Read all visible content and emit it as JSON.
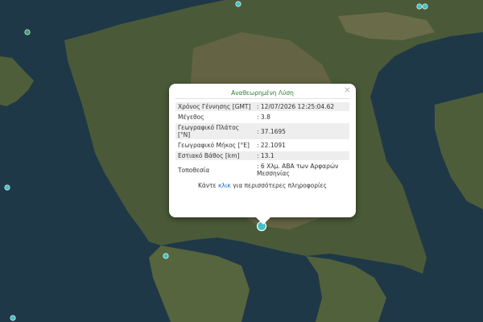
{
  "popup": {
    "title": "Αναθεωρημένη Λύση",
    "close_symbol": "×",
    "rows": [
      {
        "label": "Χρόνος Γέννησης [GMT]",
        "value": ": 12/07/2026 12:25:04.62"
      },
      {
        "label": "Μέγεθος",
        "value": ": 3.8"
      },
      {
        "label": "Γεωγραφικό Πλάτος [°N]",
        "value": ": 37.1695"
      },
      {
        "label": "Γεωγραφικό Μήκος [°E]",
        "value": ": 22.1091"
      },
      {
        "label": "Εστιακό Βάθος [km]",
        "value": ": 13.1"
      },
      {
        "label": "Τοποθεσία",
        "value": ": 6 Χλμ. ΑΒΑ των Αρφαρών Μεσσηνίας"
      }
    ],
    "footer_before": "Κάντε ",
    "footer_link": "κλικ",
    "footer_after": " για περισσότερες πληροφορίες"
  },
  "colors": {
    "title": "#2e7d32",
    "link": "#1565c0",
    "marker_fill": "#3fc1c9",
    "sea": "#1f3848",
    "land": "#4a5a38"
  },
  "markers": {
    "selected": "selected-earthquake-marker",
    "others": "earthquake-marker"
  }
}
